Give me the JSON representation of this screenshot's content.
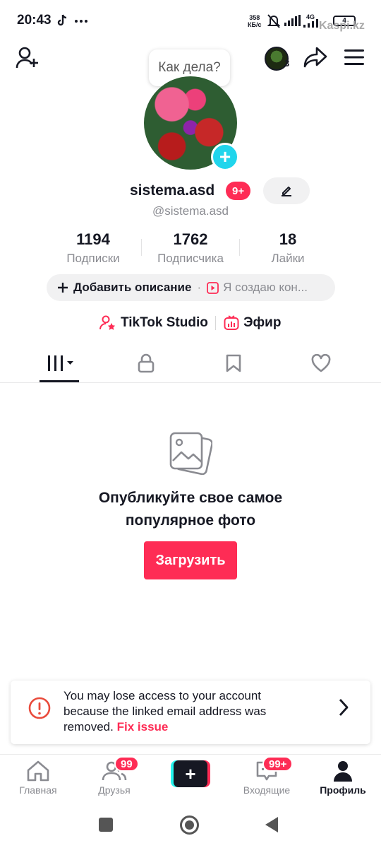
{
  "status_bar": {
    "time": "20:43",
    "speed_value": "358",
    "speed_unit": "КБ/с",
    "network": "4G",
    "battery": "4",
    "watermark": "Kaspi.kz"
  },
  "header": {
    "bubble_text": "Как дела?",
    "friends_avatar_count": "3"
  },
  "profile": {
    "username": "sistema.asd",
    "username_badge": "9+",
    "handle": "@sistema.asd"
  },
  "stats": [
    {
      "value": "1194",
      "label": "Подписки"
    },
    {
      "value": "1762",
      "label": "Подписчика"
    },
    {
      "value": "18",
      "label": "Лайки"
    }
  ],
  "description": {
    "add_label": "Добавить описание",
    "creator_label": "Я создаю кон..."
  },
  "links": {
    "studio": "TikTok Studio",
    "live": "Эфир"
  },
  "empty_state": {
    "title_line1": "Опубликуйте свое самое",
    "title_line2": "популярное фото",
    "upload_button": "Загрузить"
  },
  "warning": {
    "text": "You may lose access to your account because the linked email address was removed.",
    "link": "Fix issue"
  },
  "bottom_nav": {
    "home": "Главная",
    "friends": "Друзья",
    "friends_badge": "99",
    "inbox": "Входящие",
    "inbox_badge": "99+",
    "profile": "Профиль"
  },
  "colors": {
    "accent": "#fe2c55",
    "cyan": "#20d5ec",
    "text": "#161823",
    "muted": "#8a8b91"
  }
}
